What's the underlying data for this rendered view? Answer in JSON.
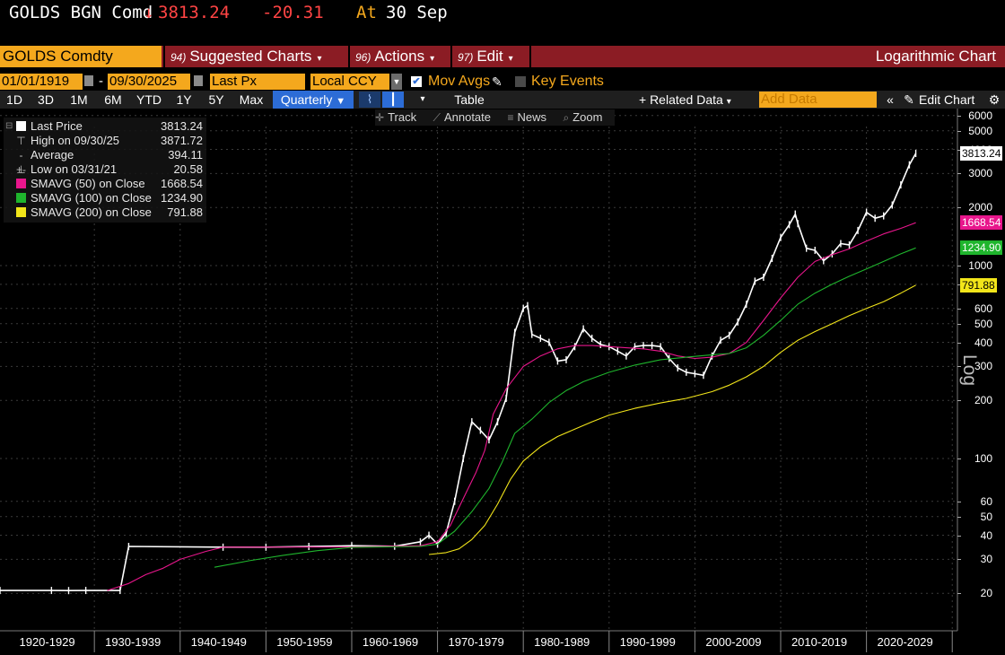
{
  "ticker": {
    "symbol": "GOLDS BGN Comd",
    "arrow": "↓",
    "price": "3813.24",
    "change": "-20.31",
    "at_label": "At",
    "date": "30 Sep"
  },
  "bar2": {
    "security": "GOLDS Comdty",
    "suggested_num": "94)",
    "suggested_label": "Suggested Charts",
    "actions_num": "96)",
    "actions_label": "Actions",
    "edit_num": "97)",
    "edit_label": "Edit",
    "chart_title": "Logarithmic Chart"
  },
  "bar3": {
    "start_date": "01/01/1919",
    "dash": "-",
    "end_date": "09/30/2025",
    "field": "Last Px",
    "currency": "Local CCY",
    "mov_avgs_label": "Mov Avgs",
    "mov_avgs_checked": true,
    "key_events_label": "Key Events",
    "key_events_checked": false
  },
  "bar4": {
    "periods": [
      "1D",
      "3D",
      "1M",
      "6M",
      "YTD",
      "1Y",
      "5Y",
      "Max"
    ],
    "frequency": "Quarterly",
    "table_label": "Table",
    "related_data_label": "+ Related Data",
    "add_data_placeholder": "Add Data",
    "edit_chart_label": "Edit Chart"
  },
  "toolbar": {
    "track": "Track",
    "annotate": "Annotate",
    "news": "News",
    "zoom": "Zoom"
  },
  "legend": [
    {
      "name": "Last Price",
      "value": "3813.24",
      "kind": "swatch",
      "color": "#ffffff"
    },
    {
      "name": "High on 09/30/25",
      "value": "3871.72",
      "kind": "high"
    },
    {
      "name": "Average",
      "value": "394.11",
      "kind": "avg"
    },
    {
      "name": "Low on 03/31/21",
      "value": "20.58",
      "kind": "low"
    },
    {
      "name": "SMAVG (50)  on Close",
      "value": "1668.54",
      "kind": "swatch",
      "color": "#e8168c"
    },
    {
      "name": "SMAVG (100)  on Close",
      "value": "1234.90",
      "kind": "swatch",
      "color": "#1fb52d"
    },
    {
      "name": "SMAVG (200)  on Close",
      "value": "791.88",
      "kind": "swatch",
      "color": "#f2e51a"
    }
  ],
  "value_tags": [
    {
      "text": "3813.24",
      "value": 3813.24,
      "bg": "#ffffff",
      "fg": "#000000"
    },
    {
      "text": "1668.54",
      "value": 1668.54,
      "bg": "#e8168c",
      "fg": "#ffffff"
    },
    {
      "text": "1234.90",
      "value": 1234.9,
      "bg": "#1fb52d",
      "fg": "#ffffff"
    },
    {
      "text": "791.88",
      "value": 791.88,
      "bg": "#f2e51a",
      "fg": "#000000"
    }
  ],
  "axis_label": "Log",
  "chart_data": {
    "type": "line",
    "scale": "log",
    "ylim": [
      20,
      6000
    ],
    "xlim": [
      1919.0,
      2030.5
    ],
    "y_ticks": [
      "6000",
      "5000",
      "4000",
      "3000",
      "2000",
      "1000",
      "800",
      "600",
      "500",
      "400",
      "300",
      "200",
      "100",
      "60",
      "50",
      "40",
      "30",
      "20"
    ],
    "y_tick_values": [
      6000,
      5000,
      4000,
      3000,
      2000,
      1000,
      800,
      600,
      500,
      400,
      300,
      200,
      100,
      60,
      50,
      40,
      30,
      20
    ],
    "x_ticks": [
      "1920-1929",
      "1930-1939",
      "1940-1949",
      "1950-1959",
      "1960-1969",
      "1970-1979",
      "1980-1989",
      "1990-1999",
      "2000-2009",
      "2010-2019",
      "2020-2029"
    ],
    "x_tick_centers": [
      1924.5,
      1934.5,
      1944.5,
      1954.5,
      1964.5,
      1974.5,
      1984.5,
      1994.5,
      2004.5,
      2014.5,
      2024.5
    ],
    "x_dividers": [
      1930,
      1940,
      1950,
      1960,
      1970,
      1980,
      1990,
      2000,
      2010,
      2020,
      2030
    ],
    "grid": true,
    "series": [
      {
        "name": "Last Price",
        "color": "#ffffff",
        "points": [
          [
            1919,
            20.7
          ],
          [
            1925,
            20.7
          ],
          [
            1927,
            20.67
          ],
          [
            1929,
            20.7
          ],
          [
            1933,
            20.7
          ],
          [
            1934,
            35
          ],
          [
            1945,
            34.7
          ],
          [
            1950,
            34.7
          ],
          [
            1955,
            35
          ],
          [
            1960,
            35.3
          ],
          [
            1965,
            35.1
          ],
          [
            1968,
            37
          ],
          [
            1969,
            40
          ],
          [
            1970,
            36
          ],
          [
            1971,
            41
          ],
          [
            1972,
            60
          ],
          [
            1973,
            100
          ],
          [
            1974,
            155
          ],
          [
            1975,
            140
          ],
          [
            1976,
            125
          ],
          [
            1977,
            155
          ],
          [
            1978,
            205
          ],
          [
            1979,
            450
          ],
          [
            1980,
            600
          ],
          [
            1980.5,
            620
          ],
          [
            1981,
            440
          ],
          [
            1982,
            420
          ],
          [
            1983,
            400
          ],
          [
            1984,
            320
          ],
          [
            1985,
            325
          ],
          [
            1986,
            380
          ],
          [
            1987,
            470
          ],
          [
            1988,
            420
          ],
          [
            1989,
            390
          ],
          [
            1990,
            380
          ],
          [
            1991,
            360
          ],
          [
            1992,
            340
          ],
          [
            1993,
            380
          ],
          [
            1994,
            385
          ],
          [
            1995,
            385
          ],
          [
            1996,
            380
          ],
          [
            1997,
            330
          ],
          [
            1998,
            295
          ],
          [
            1999,
            280
          ],
          [
            2000,
            275
          ],
          [
            2001,
            270
          ],
          [
            2002,
            340
          ],
          [
            2003,
            410
          ],
          [
            2004,
            435
          ],
          [
            2005,
            510
          ],
          [
            2006,
            630
          ],
          [
            2007,
            830
          ],
          [
            2008,
            870
          ],
          [
            2009,
            1090
          ],
          [
            2010,
            1400
          ],
          [
            2011,
            1630
          ],
          [
            2011.7,
            1850
          ],
          [
            2012,
            1650
          ],
          [
            2013,
            1230
          ],
          [
            2014,
            1200
          ],
          [
            2015,
            1060
          ],
          [
            2016,
            1150
          ],
          [
            2017,
            1300
          ],
          [
            2018,
            1280
          ],
          [
            2019,
            1520
          ],
          [
            2020,
            1890
          ],
          [
            2021,
            1760
          ],
          [
            2022,
            1810
          ],
          [
            2023,
            2060
          ],
          [
            2024,
            2620
          ],
          [
            2025,
            3330
          ],
          [
            2025.75,
            3813.24
          ]
        ]
      },
      {
        "name": "SMAVG (50)",
        "color": "#e8168c",
        "points": [
          [
            1931.5,
            20.7
          ],
          [
            1934,
            22.5
          ],
          [
            1936,
            25
          ],
          [
            1938,
            27
          ],
          [
            1940,
            30
          ],
          [
            1943,
            33
          ],
          [
            1945,
            34.7
          ],
          [
            1960,
            34.8
          ],
          [
            1968,
            35.3
          ],
          [
            1970,
            37
          ],
          [
            1971.5,
            45
          ],
          [
            1973,
            62
          ],
          [
            1974.5,
            85
          ],
          [
            1975.5,
            110
          ],
          [
            1976.5,
            170
          ],
          [
            1978,
            230
          ],
          [
            1980,
            300
          ],
          [
            1982,
            340
          ],
          [
            1984,
            370
          ],
          [
            1986,
            385
          ],
          [
            1988,
            385
          ],
          [
            1990,
            380
          ],
          [
            1992,
            375
          ],
          [
            1994,
            370
          ],
          [
            1996,
            360
          ],
          [
            1998,
            340
          ],
          [
            2000,
            330
          ],
          [
            2002,
            335
          ],
          [
            2004,
            350
          ],
          [
            2006,
            400
          ],
          [
            2008,
            520
          ],
          [
            2010,
            680
          ],
          [
            2012,
            870
          ],
          [
            2014,
            1050
          ],
          [
            2016,
            1140
          ],
          [
            2018,
            1220
          ],
          [
            2020,
            1340
          ],
          [
            2022,
            1460
          ],
          [
            2024,
            1560
          ],
          [
            2025.75,
            1668.54
          ]
        ]
      },
      {
        "name": "SMAVG (100)",
        "color": "#1fb52d",
        "points": [
          [
            1944,
            27.3
          ],
          [
            1948,
            29.5
          ],
          [
            1952,
            31.5
          ],
          [
            1956,
            33.3
          ],
          [
            1960,
            34.6
          ],
          [
            1968,
            35
          ],
          [
            1970,
            36
          ],
          [
            1972,
            42
          ],
          [
            1974,
            53
          ],
          [
            1976,
            70
          ],
          [
            1977.5,
            95
          ],
          [
            1979,
            135
          ],
          [
            1981,
            160
          ],
          [
            1983,
            195
          ],
          [
            1985,
            225
          ],
          [
            1987,
            250
          ],
          [
            1990,
            280
          ],
          [
            1993,
            305
          ],
          [
            1996,
            325
          ],
          [
            1999,
            335
          ],
          [
            2002,
            345
          ],
          [
            2004,
            350
          ],
          [
            2006,
            375
          ],
          [
            2008,
            435
          ],
          [
            2010,
            520
          ],
          [
            2012,
            630
          ],
          [
            2014,
            720
          ],
          [
            2016,
            800
          ],
          [
            2018,
            880
          ],
          [
            2020,
            960
          ],
          [
            2022,
            1050
          ],
          [
            2024,
            1150
          ],
          [
            2025.75,
            1234.9
          ]
        ]
      },
      {
        "name": "SMAVG (200)",
        "color": "#f2e51a",
        "points": [
          [
            1969,
            31.8
          ],
          [
            1971,
            32.5
          ],
          [
            1972.5,
            34
          ],
          [
            1974,
            38
          ],
          [
            1975.5,
            45
          ],
          [
            1977,
            58
          ],
          [
            1978.5,
            78
          ],
          [
            1980,
            97
          ],
          [
            1982,
            115
          ],
          [
            1984,
            130
          ],
          [
            1986,
            142
          ],
          [
            1988,
            155
          ],
          [
            1990,
            168
          ],
          [
            1993,
            182
          ],
          [
            1996,
            194
          ],
          [
            1999,
            205
          ],
          [
            2002,
            222
          ],
          [
            2004,
            240
          ],
          [
            2006,
            265
          ],
          [
            2008,
            300
          ],
          [
            2010,
            355
          ],
          [
            2012,
            410
          ],
          [
            2014,
            455
          ],
          [
            2016,
            500
          ],
          [
            2018,
            550
          ],
          [
            2020,
            600
          ],
          [
            2022,
            650
          ],
          [
            2024,
            720
          ],
          [
            2025.75,
            791.88
          ]
        ]
      }
    ]
  }
}
